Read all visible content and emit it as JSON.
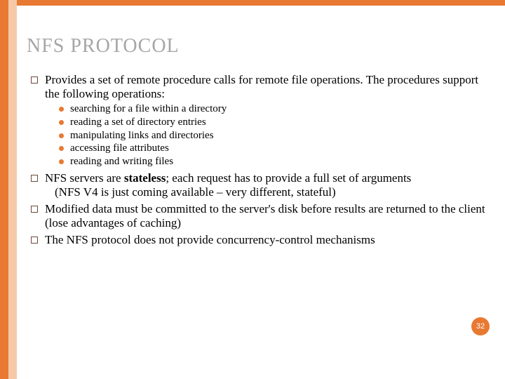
{
  "slide": {
    "title": "NFS PROTOCOL",
    "page_number": "32",
    "bullets": [
      {
        "text": "Provides a set of remote procedure calls for remote file operations.  The procedures support the following operations:",
        "sub": [
          "searching for a file within a directory",
          "reading a set of directory entries",
          "manipulating links and directories",
          "accessing file attributes",
          "reading and writing files"
        ]
      },
      {
        "text_pre": "NFS servers are ",
        "bold": "stateless",
        "text_post": "; each request has to provide a full set of arguments",
        "note": "(NFS V4 is just coming available – very different, stateful)"
      },
      {
        "text": "Modified data must be committed to the server's disk before results are returned to the client (lose advantages of caching)"
      },
      {
        "text": "The NFS protocol does not provide concurrency-control mechanisms"
      }
    ]
  }
}
